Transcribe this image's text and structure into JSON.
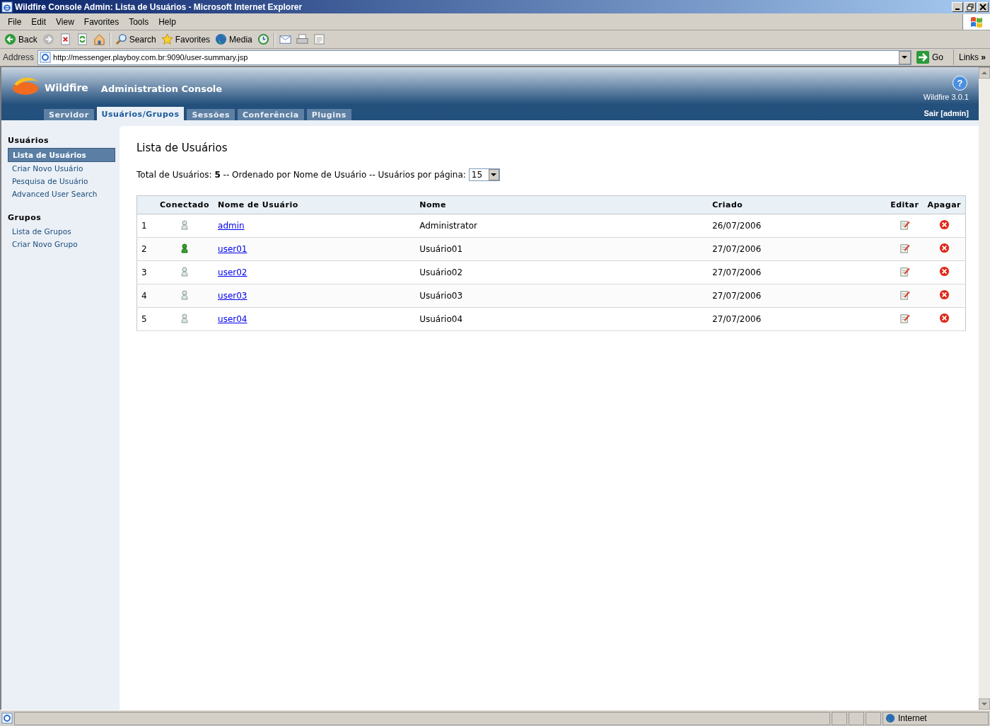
{
  "window": {
    "title": "Wildfire Console Admin: Lista de Usuários - Microsoft Internet Explorer"
  },
  "menu": [
    "File",
    "Edit",
    "View",
    "Favorites",
    "Tools",
    "Help"
  ],
  "toolbar": [
    {
      "kind": "back",
      "label": "Back"
    },
    {
      "kind": "forward"
    },
    {
      "kind": "stop"
    },
    {
      "kind": "refresh"
    },
    {
      "kind": "home"
    },
    {
      "kind": "search",
      "label": "Search"
    },
    {
      "kind": "favorites",
      "label": "Favorites"
    },
    {
      "kind": "media",
      "label": "Media"
    },
    {
      "kind": "history"
    },
    {
      "kind": "mail"
    },
    {
      "kind": "print"
    },
    {
      "kind": "edit"
    }
  ],
  "address": {
    "label": "Address",
    "url": "http://messenger.playboy.com.br:9090/user-summary.jsp",
    "go": "Go",
    "links": "Links",
    "more": "»"
  },
  "header": {
    "help": "?",
    "brand": "Wildfire",
    "title": "Administration Console",
    "version": "Wildfire 3.0.1",
    "logout": "Sair [admin]"
  },
  "tabs": [
    {
      "label": "Servidor",
      "selected": false
    },
    {
      "label": "Usuários/Grupos",
      "selected": true
    },
    {
      "label": "Sessões",
      "selected": false
    },
    {
      "label": "Conferência",
      "selected": false
    },
    {
      "label": "Plugins",
      "selected": false
    }
  ],
  "sidebar": [
    {
      "title": "Usuários",
      "items": [
        {
          "label": "Lista de Usuários",
          "selected": true
        },
        {
          "label": "Criar Novo Usuário",
          "selected": false
        },
        {
          "label": "Pesquisa de Usuário",
          "selected": false
        },
        {
          "label": "Advanced User Search",
          "selected": false
        }
      ]
    },
    {
      "title": "Grupos",
      "items": [
        {
          "label": "Lista de Grupos",
          "selected": false
        },
        {
          "label": "Criar Novo Grupo",
          "selected": false
        }
      ]
    }
  ],
  "content": {
    "title": "Lista de Usuários",
    "summary": {
      "total_label": "Total de Usuários:",
      "total": "5",
      "sort": "-- Ordenado por Nome de Usuário -- Usuários por página:",
      "per_page": "15"
    }
  },
  "table": {
    "columns": [
      "",
      "Conectado",
      "Nome de Usuário",
      "Nome",
      "Criado",
      "Editar",
      "Apagar"
    ],
    "rows": [
      {
        "index": "1",
        "online": false,
        "username": "admin",
        "name": "Administrator",
        "created": "26/07/2006"
      },
      {
        "index": "2",
        "online": true,
        "username": "user01",
        "name": "Usuário01",
        "created": "27/07/2006"
      },
      {
        "index": "3",
        "online": false,
        "username": "user02",
        "name": "Usuário02",
        "created": "27/07/2006"
      },
      {
        "index": "4",
        "online": false,
        "username": "user03",
        "name": "Usuário03",
        "created": "27/07/2006"
      },
      {
        "index": "5",
        "online": false,
        "username": "user04",
        "name": "Usuário04",
        "created": "27/07/2006"
      }
    ]
  },
  "status_bar": {
    "zone": "Internet"
  }
}
